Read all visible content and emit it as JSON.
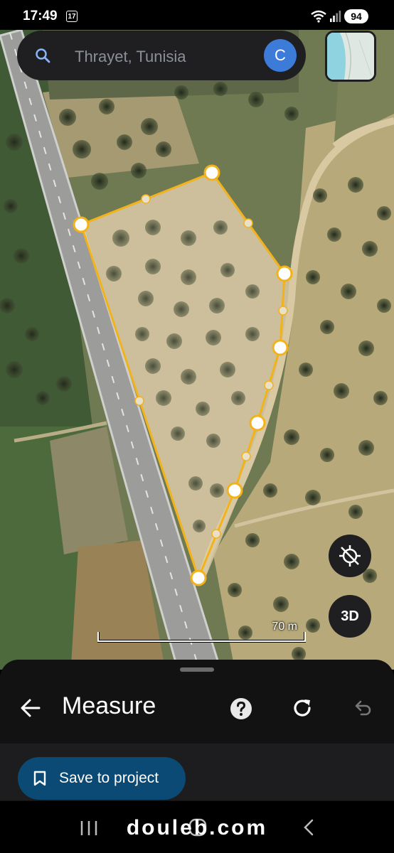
{
  "status_bar": {
    "time": "17:49",
    "date_badge": "17",
    "battery": "94",
    "icons": [
      "wifi-icon",
      "signal-icon",
      "battery-icon"
    ]
  },
  "search": {
    "placeholder": "Thrayet, Tunisia",
    "avatar_letter": "C",
    "avatar_color": "#3d7bd9"
  },
  "map": {
    "scale_label": "70 m",
    "button_3d": "3D",
    "accent_color": "#f2b21a",
    "polygon_vertex_count": 8
  },
  "sheet": {
    "title": "Measure",
    "save_label": "Save to project",
    "icons": [
      "back-arrow-icon",
      "help-icon",
      "refresh-icon",
      "undo-icon",
      "bookmark-icon"
    ]
  },
  "watermark": "douleb.com"
}
